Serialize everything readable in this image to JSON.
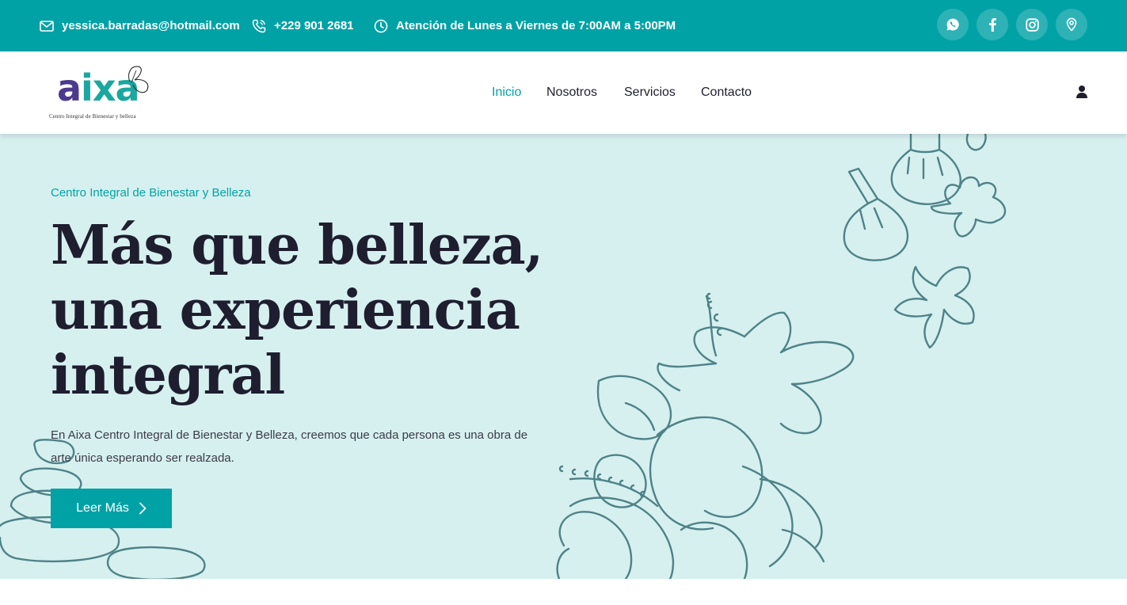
{
  "topbar": {
    "email": "yessica.barradas@hotmail.com",
    "phone": "+229 901 2681",
    "hours": "Atención de Lunes a Viernes de 7:00AM a 5:00PM",
    "social_icons": [
      "whatsapp-icon",
      "facebook-icon",
      "instagram-icon",
      "location-icon"
    ]
  },
  "header": {
    "logo_word": "aixa",
    "logo_subtitle": "Centro Integral de Bienestar y belleza",
    "nav": {
      "inicio": "Inicio",
      "nosotros": "Nosotros",
      "servicios": "Servicios",
      "contacto": "Contacto"
    }
  },
  "hero": {
    "eyebrow": "Centro Integral de Bienestar y Belleza",
    "headline": [
      "Más que belleza,",
      "una experiencia",
      "integral"
    ],
    "description": "En Aixa Centro Integral de Bienestar y Belleza, creemos que cada persona es una obra de arte única esperando ser realzada.",
    "button_label": "Leer Más"
  },
  "colors": {
    "brand_teal": "#00a2a6",
    "hero_bg": "#d6f0ef",
    "heading_dark": "#1e1e2f",
    "logo_purple": "#4b3a8f",
    "illustration": "#4e8287"
  }
}
